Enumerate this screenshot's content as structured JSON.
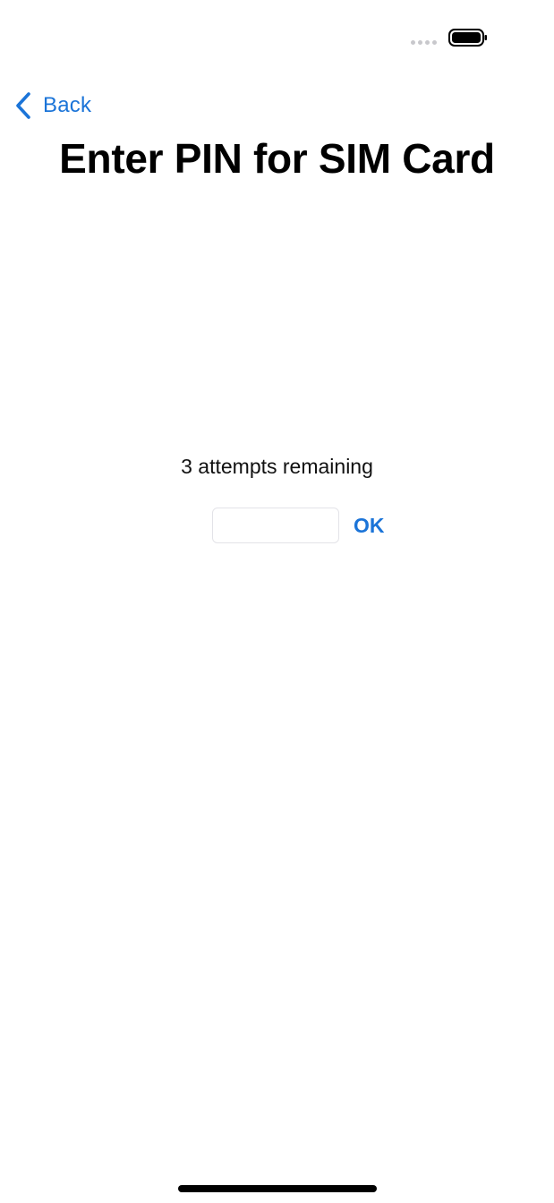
{
  "status_bar": {
    "signal_icon": "cellular-signal-dots-icon",
    "battery_icon": "battery-full-icon"
  },
  "nav": {
    "back_label": "Back",
    "back_icon": "chevron-left-icon"
  },
  "page": {
    "title": "Enter PIN for SIM Card",
    "attempts_text": "3 attempts remaining"
  },
  "pin_form": {
    "pin_value": "",
    "pin_placeholder": "",
    "ok_label": "OK"
  },
  "colors": {
    "accent": "#1b74d8",
    "text": "#000000",
    "background": "#ffffff"
  }
}
